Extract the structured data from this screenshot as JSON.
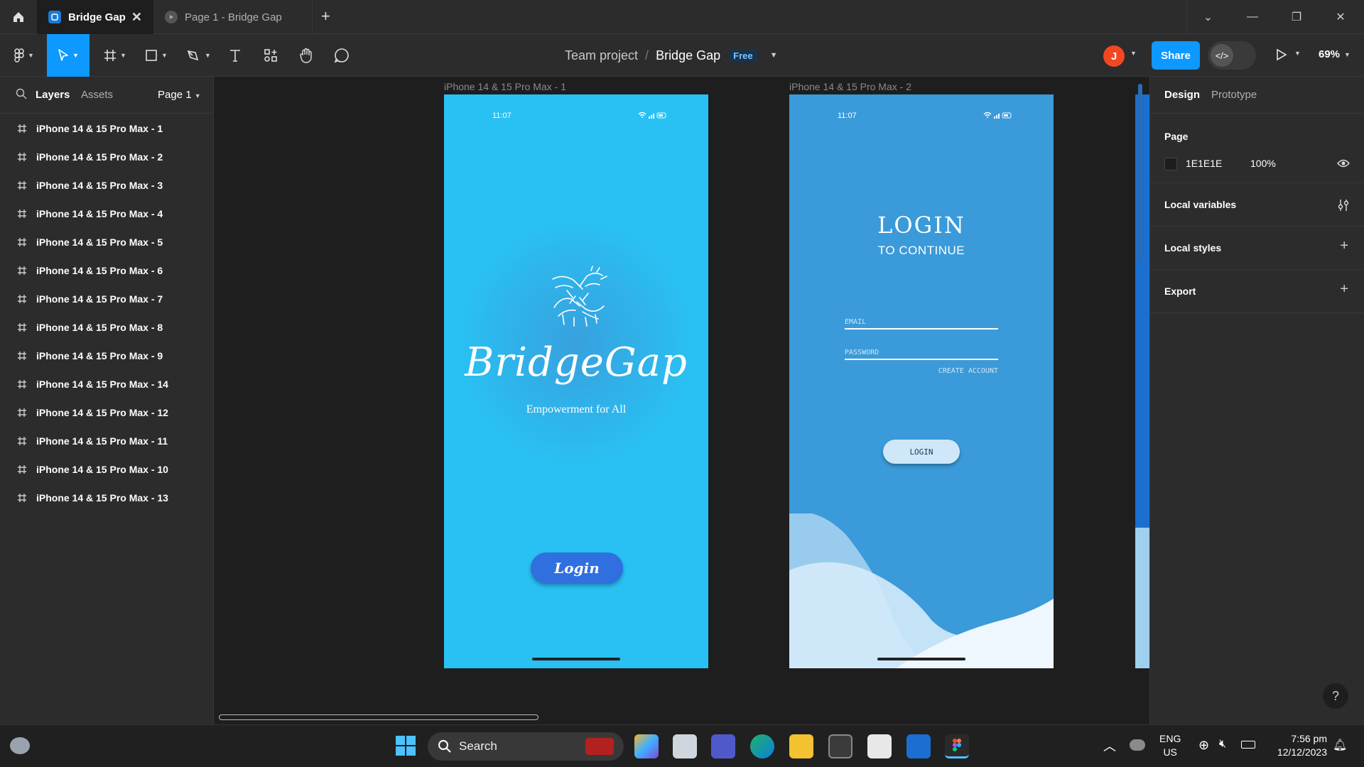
{
  "titlebar": {
    "tabs": [
      {
        "label": "Bridge Gap",
        "active": true
      },
      {
        "label": "Page 1 - Bridge Gap",
        "active": false
      }
    ]
  },
  "toolbar": {
    "breadcrumb_team": "Team project",
    "breadcrumb_separator": "/",
    "file_name": "Bridge Gap",
    "plan_badge": "Free",
    "avatar_initial": "J",
    "share_label": "Share",
    "zoom": "69%"
  },
  "left_panel": {
    "tab_layers": "Layers",
    "tab_assets": "Assets",
    "page_selector": "Page 1",
    "layers": [
      "iPhone 14 & 15 Pro Max - 1",
      "iPhone 14 & 15 Pro Max - 2",
      "iPhone 14 & 15 Pro Max - 3",
      "iPhone 14 & 15 Pro Max - 4",
      "iPhone 14 & 15 Pro Max - 5",
      "iPhone 14 & 15 Pro Max - 6",
      "iPhone 14 & 15 Pro Max - 7",
      "iPhone 14 & 15 Pro Max - 8",
      "iPhone 14 & 15 Pro Max - 9",
      "iPhone 14 & 15 Pro Max - 14",
      "iPhone 14 & 15 Pro Max - 12",
      "iPhone 14 & 15 Pro Max - 11",
      "iPhone 14 & 15 Pro Max - 10",
      "iPhone 14 & 15 Pro Max - 13"
    ]
  },
  "canvas": {
    "frame1": {
      "label": "iPhone 14 & 15 Pro Max - 1",
      "time": "11:07",
      "brand": "BridgeGap",
      "tagline": "Empowerment for All",
      "button": "Login"
    },
    "frame2": {
      "label": "iPhone 14 & 15 Pro Max - 2",
      "time": "11:07",
      "title": "LOGIN",
      "subtitle": "TO CONTINUE",
      "email_placeholder": "EMAIL",
      "password_placeholder": "PASSWORD",
      "create_account": "CREATE ACCOUNT",
      "button": "LOGIN"
    }
  },
  "right_panel": {
    "tab_design": "Design",
    "tab_prototype": "Prototype",
    "page_section": "Page",
    "page_color": "1E1E1E",
    "page_opacity": "100%",
    "local_variables": "Local variables",
    "local_styles": "Local styles",
    "export": "Export",
    "help": "?"
  },
  "taskbar": {
    "search_label": "Search",
    "lang_line1": "ENG",
    "lang_line2": "US",
    "time": "7:56 pm",
    "date": "12/12/2023"
  },
  "colors": {
    "accent": "#0d99ff",
    "frame1_bg": "#29c1f3",
    "frame2_bg": "#3b9ad9",
    "login_button": "#2f6fe0"
  }
}
